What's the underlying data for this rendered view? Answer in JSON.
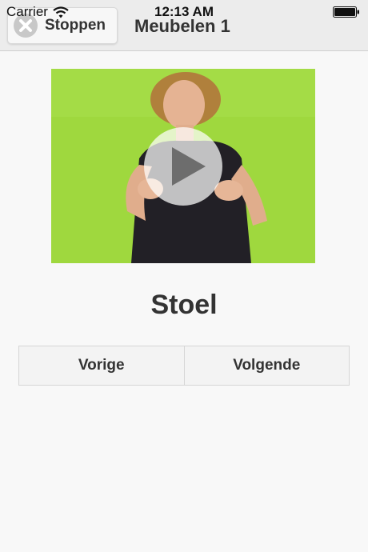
{
  "status_bar": {
    "carrier": "Carrier",
    "time": "12:13 AM",
    "wifi_icon": "wifi-icon",
    "battery_icon": "battery-icon"
  },
  "nav": {
    "stop_label": "Stoppen",
    "stop_icon": "close-circle-icon",
    "title": "Meubelen 1"
  },
  "video": {
    "play_icon": "play-icon",
    "background_color": "#9ad63a"
  },
  "word": {
    "title": "Stoel"
  },
  "navigation": {
    "previous_label": "Vorige",
    "next_label": "Volgende"
  }
}
